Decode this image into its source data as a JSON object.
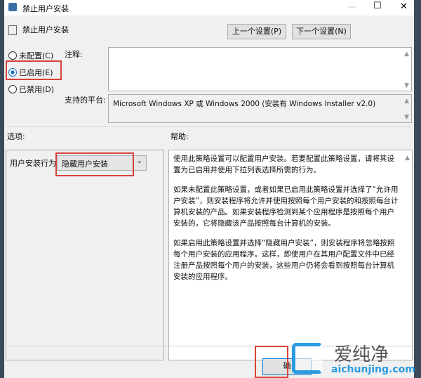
{
  "window": {
    "title": "禁止用户安装",
    "minimize": "—",
    "maximize": "☐",
    "close": "✕"
  },
  "header": {
    "title": "禁止用户安装",
    "prev_button": "上一个设置(P)",
    "next_button": "下一个设置(N)"
  },
  "radios": [
    {
      "label": "未配置(C)",
      "checked": false
    },
    {
      "label": "已启用(E)",
      "checked": true
    },
    {
      "label": "已禁用(D)",
      "checked": false
    }
  ],
  "comment": {
    "label": "注释:",
    "value": ""
  },
  "platform": {
    "label": "支持的平台:",
    "value": "Microsoft Windows XP 或 Windows 2000 (安装有 Windows Installer v2.0)"
  },
  "options": {
    "label": "选项:",
    "field_label": "用户安装行为:",
    "selected": "隐藏用户安装"
  },
  "help": {
    "label": "帮助:",
    "paragraphs": [
      "使用此策略设置可以配置用户安装。若要配置此策略设置，请将其设置为已启用并使用下拉列表选择所需的行为。",
      "如果未配置此策略设置，或者如果已启用此策略设置并选择了“允许用户安装”，则安装程序将允许并使用按照每个用户安装的和按照每台计算机安装的产品。如果安装程序检测到某个应用程序是按照每个用户安装的，它将隐藏该产品按照每台计算机的安装。",
      "如果启用此策略设置并选择“隐藏用户安装”，则安装程序将忽略按照每个用户安装的应用程序。这样，即使用户在其用户配置文件中已经注册产品按照每个用户的安装，这些用户仍将会看到按照每台计算机安装的应用程序。"
    ]
  },
  "footer": {
    "ok_button": "确"
  },
  "watermark": {
    "brand": "爱纯净",
    "url": "aichunjing.com"
  }
}
